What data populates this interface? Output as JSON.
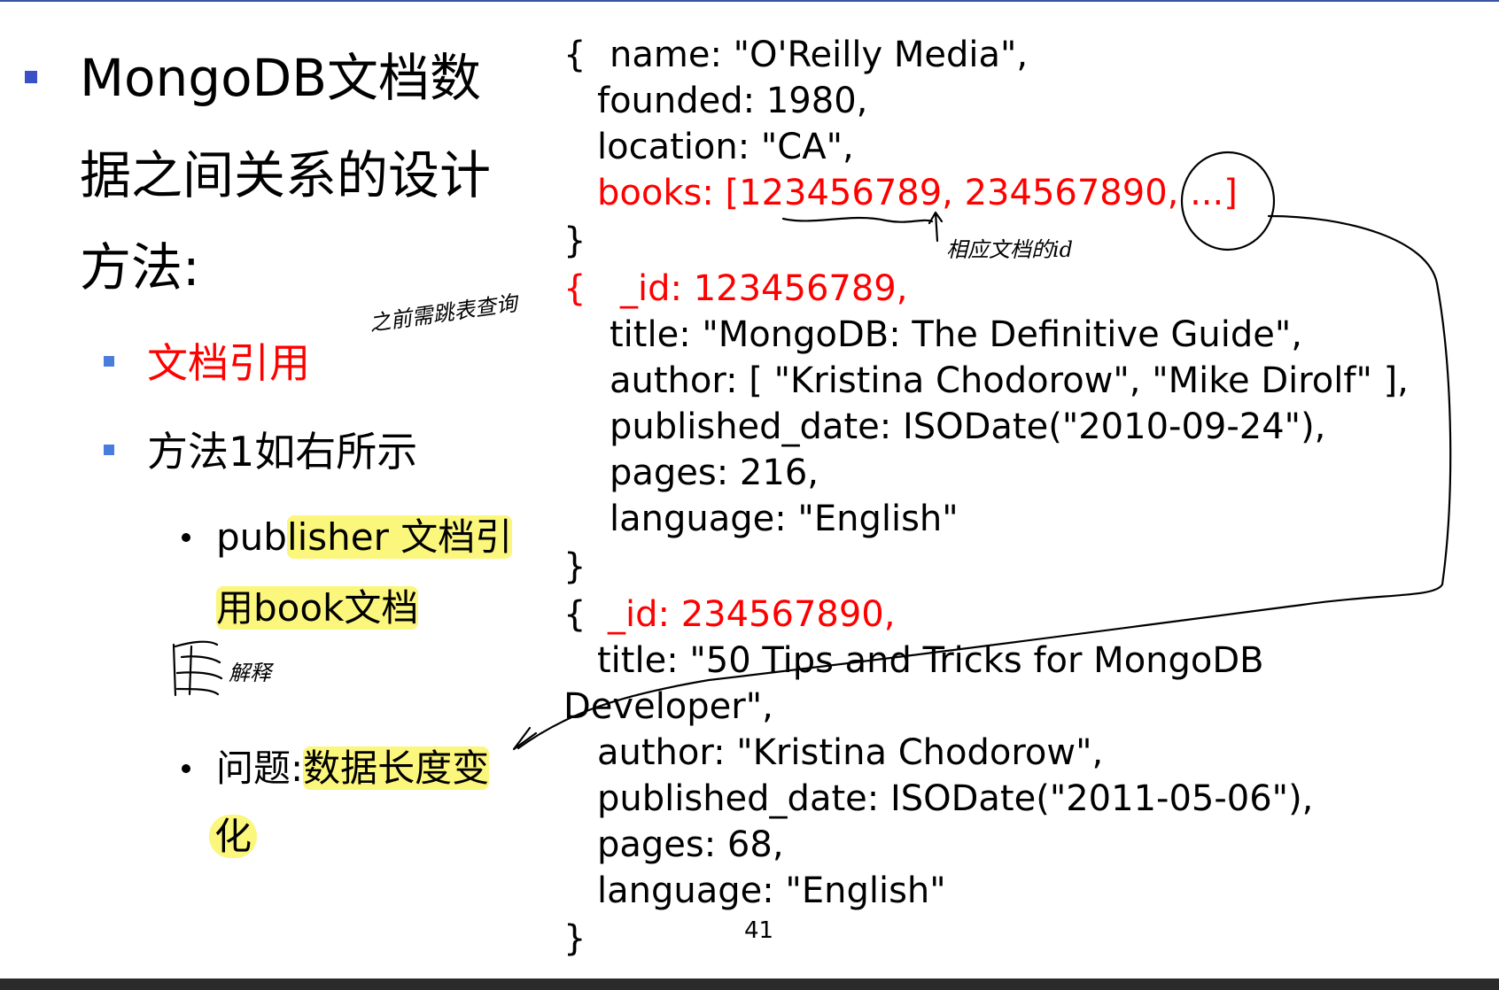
{
  "left": {
    "heading_line1": "MongoDB文档数",
    "heading_line2": "据之间关系的设计",
    "heading_line3": "方法:",
    "item1": "文档引用",
    "item2": "方法1如右所示",
    "sub1_part1": "pub",
    "sub1_part2": "lisher 文档引",
    "sub1_line2": "用book文档",
    "sub2_part1": "问题:",
    "sub2_part2": "数据长度变",
    "sub2_line2": "化"
  },
  "code": {
    "publisher": {
      "open": "{",
      "name": "name: \"O'Reilly Media\",",
      "founded": "founded: 1980,",
      "location": "location: \"CA\",",
      "books": "books: [123456789, 234567890, ...]",
      "close": "}"
    },
    "book1": {
      "open": "{",
      "id": "_id: 123456789,",
      "title": "title: \"MongoDB: The Definitive Guide\",",
      "author": "author: [ \"Kristina Chodorow\", \"Mike Dirolf\" ],",
      "published": "published_date: ISODate(\"2010-09-24\"),",
      "pages": "pages: 216,",
      "language": "language: \"English\"",
      "close": "}"
    },
    "book2": {
      "open": "{",
      "id": "_id: 234567890,",
      "title": "title: \"50 Tips and Tricks for MongoDB",
      "title_cont": "Developer\",",
      "author": "author: \"Kristina Chodorow\",",
      "published": "published_date: ISODate(\"2011-05-06\"),",
      "pages": "pages: 68,",
      "language": "language: \"English\"",
      "close": "}"
    }
  },
  "annotations": {
    "note_id": "相应文档的id",
    "note_query": "之前需跳表查询",
    "note_explain": "解释"
  },
  "page_number": "41",
  "colors": {
    "accent_bullet": "#3b4fc6",
    "reference_red": "#ff0000",
    "highlight": "#fbf67c",
    "top_rule": "#3a54a4"
  }
}
